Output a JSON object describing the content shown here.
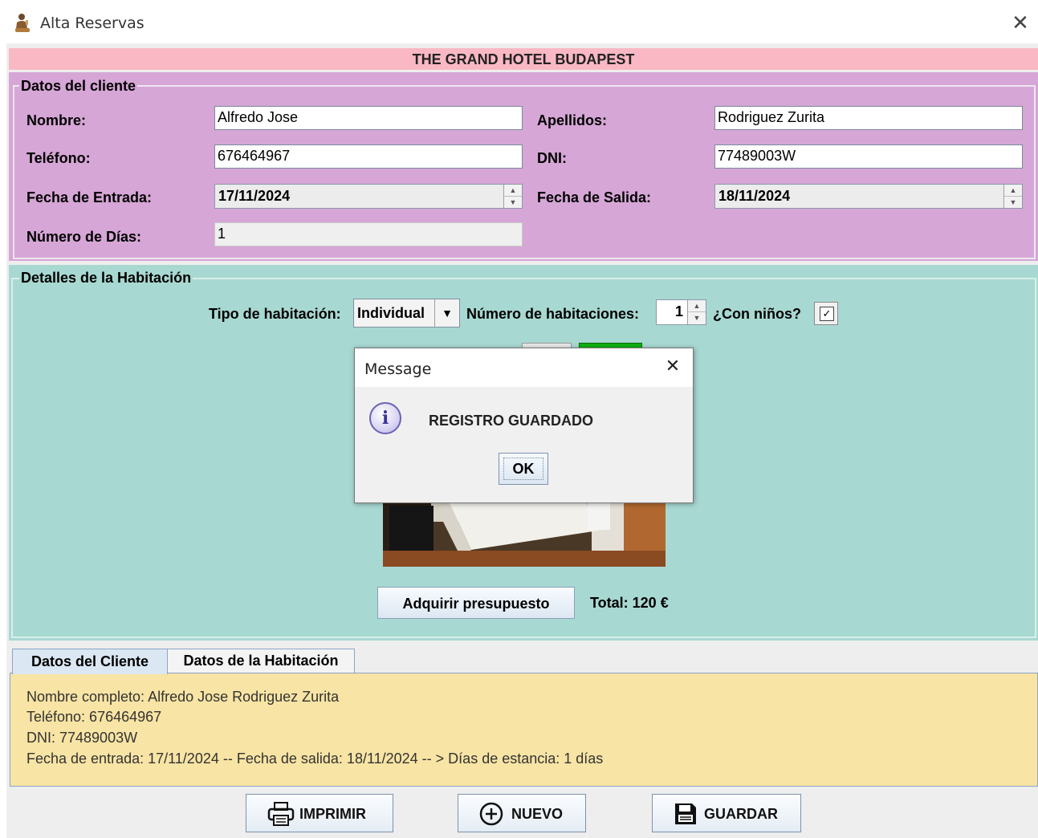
{
  "window": {
    "title": "Alta Reservas",
    "close_glyph": "✕"
  },
  "banner": {
    "hotel_name": "THE GRAND HOTEL BUDAPEST"
  },
  "client_section": {
    "legend": "Datos del cliente",
    "name_label": "Nombre:",
    "name_value": "Alfredo Jose",
    "surname_label": "Apellidos:",
    "surname_value": "Rodriguez Zurita",
    "phone_label": "Teléfono:",
    "phone_value": "676464967",
    "dni_label": "DNI:",
    "dni_value": "77489003W",
    "checkin_label": "Fecha de Entrada:",
    "checkin_value": "17/11/2024",
    "checkout_label": "Fecha de Salida:",
    "checkout_value": "18/11/2024",
    "days_label": "Número de Días:",
    "days_value": "1"
  },
  "room_section": {
    "legend": "Detalles de la Habitación",
    "type_label": "Tipo de habitación:",
    "type_value": "Individual",
    "rooms_label": "Número de habitaciones:",
    "rooms_value": "1",
    "children_label": "¿Con niños?",
    "children_checked": true,
    "children_check_glyph": "✓",
    "budget_button": "Adquirir presupuesto",
    "total": "Total: 120 €"
  },
  "tabs": {
    "client_tab": "Datos del Cliente",
    "room_tab": "Datos de la Habitación",
    "summary": {
      "line1": "Nombre completo: Alfredo Jose Rodriguez Zurita",
      "line2": "Teléfono: 676464967",
      "line3": "DNI: 77489003W",
      "line4": "Fecha de entrada: 17/11/2024 -- Fecha de salida: 18/11/2024 -- > Días de estancia: 1 días"
    }
  },
  "buttons": {
    "print": "IMPRIMIR",
    "new": "NUEVO",
    "save": "GUARDAR"
  },
  "dialog": {
    "title": "Message",
    "message": "REGISTRO GUARDADO",
    "ok": "OK",
    "close_glyph": "✕",
    "info_glyph": "i"
  },
  "colors": {
    "banner": "#f9b8c4",
    "client_panel": "#d6a6d6",
    "room_panel": "#a8d8d2",
    "summary_panel": "#f8e4a4"
  }
}
